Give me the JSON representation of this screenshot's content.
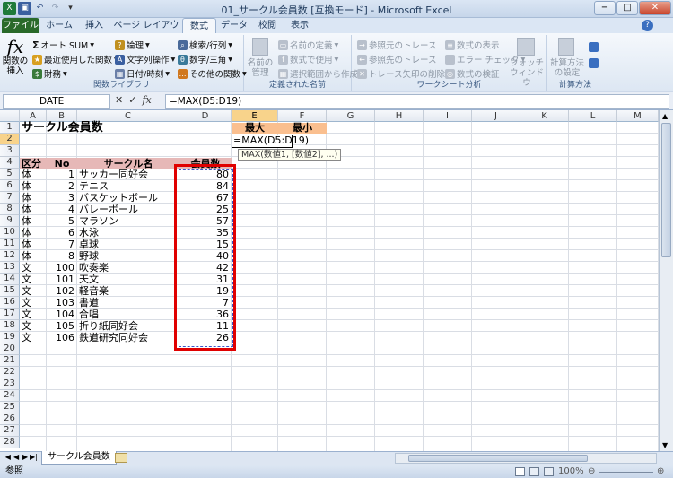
{
  "window": {
    "title": "01_サークル会員数 [互換モード] - Microsoft Excel",
    "controls": [
      "−",
      "□",
      "✕"
    ]
  },
  "tabs": [
    "ファイル",
    "ホーム",
    "挿入",
    "ページ レイアウト",
    "数式",
    "データ",
    "校閲",
    "表示"
  ],
  "ribbon": {
    "insert_function": "関数の\n挿入",
    "function_library": {
      "autosum": "オート SUM",
      "recent": "最近使用した関数",
      "financial": "財務",
      "logical": "論理",
      "text": "文字列操作",
      "datetime": "日付/時刻",
      "lookup": "検索/行列",
      "math": "数学/三角",
      "more": "その他の関数",
      "label": "関数ライブラリ"
    },
    "defined_names": {
      "manager": "名前の\n管理",
      "define": "名前の定義",
      "use_in_formula": "数式で使用",
      "create": "選択範囲から作成",
      "label": "定義された名前"
    },
    "formula_auditing": {
      "trace_precedents": "参照元のトレース",
      "trace_dependents": "参照先のトレース",
      "remove_arrows": "トレース矢印の削除",
      "show_formulas": "数式の表示",
      "error_check": "エラー チェック",
      "evaluate": "数式の検証",
      "watch": "ウォッチ\nウィンドウ",
      "label": "ワークシート分析"
    },
    "calculation": {
      "options": "計算方法\nの設定",
      "label": "計算方法"
    }
  },
  "formula_bar": {
    "name_box": "DATE",
    "formula": "=MAX(D5:D19)"
  },
  "columns": [
    "A",
    "B",
    "C",
    "D",
    "E",
    "F",
    "G",
    "H",
    "I",
    "J",
    "K",
    "L",
    "M"
  ],
  "sheet": {
    "title": "サークル会員数",
    "header": {
      "kubun": "区分",
      "no": "No",
      "name": "サークル名",
      "members": "会員数"
    },
    "e1": "最大",
    "f1": "最小",
    "e2_edit": "=MAX(D5:D19)",
    "tooltip": "MAX(数値1, [数値2], ...)",
    "rows": [
      {
        "kubun": "体",
        "no": "1",
        "name": "サッカー同好会",
        "members": "80"
      },
      {
        "kubun": "体",
        "no": "2",
        "name": "テニス",
        "members": "84"
      },
      {
        "kubun": "体",
        "no": "3",
        "name": "バスケットボール",
        "members": "67"
      },
      {
        "kubun": "体",
        "no": "4",
        "name": "バレーボール",
        "members": "25"
      },
      {
        "kubun": "体",
        "no": "5",
        "name": "マラソン",
        "members": "57"
      },
      {
        "kubun": "体",
        "no": "6",
        "name": "水泳",
        "members": "35"
      },
      {
        "kubun": "体",
        "no": "7",
        "name": "卓球",
        "members": "15"
      },
      {
        "kubun": "体",
        "no": "8",
        "name": "野球",
        "members": "40"
      },
      {
        "kubun": "文",
        "no": "100",
        "name": "吹奏楽",
        "members": "42"
      },
      {
        "kubun": "文",
        "no": "101",
        "name": "天文",
        "members": "31"
      },
      {
        "kubun": "文",
        "no": "102",
        "name": "軽音楽",
        "members": "19"
      },
      {
        "kubun": "文",
        "no": "103",
        "name": "書道",
        "members": "7"
      },
      {
        "kubun": "文",
        "no": "104",
        "name": "合唱",
        "members": "36"
      },
      {
        "kubun": "文",
        "no": "105",
        "name": "折り紙同好会",
        "members": "11"
      },
      {
        "kubun": "文",
        "no": "106",
        "name": "鉄道研究同好会",
        "members": "26"
      }
    ]
  },
  "sheet_tab": "サークル会員数",
  "status": {
    "mode": "参照",
    "zoom": "100%"
  },
  "colors": {
    "header_fill": "#e6b8b7",
    "e1_fill": "#fabf8f",
    "highlight": "#e00000"
  }
}
